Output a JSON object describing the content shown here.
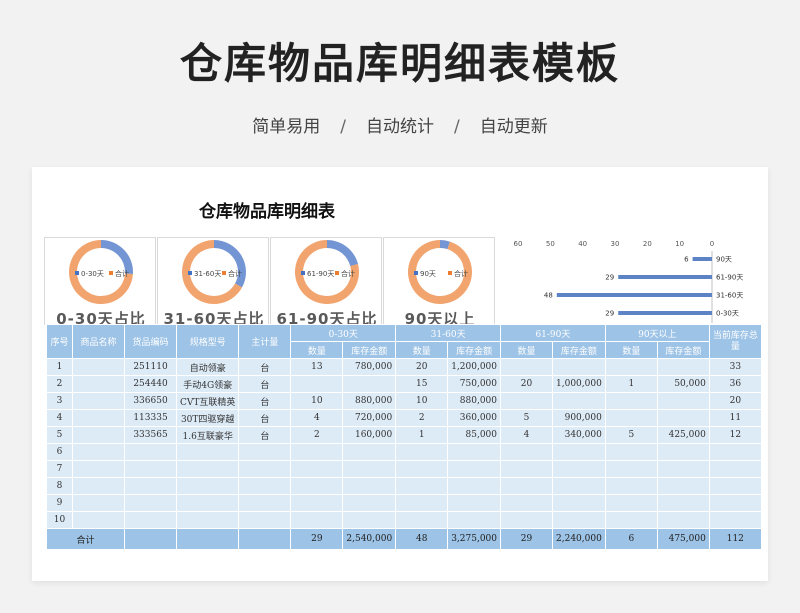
{
  "hero": {
    "title": "仓库物品库明细表模板",
    "subtitle": [
      "简单易用",
      "自动统计",
      "自动更新"
    ],
    "separator": "/"
  },
  "sheet_title": "仓库物品库明细表",
  "donuts": [
    {
      "legend": [
        "0-30天",
        "合计"
      ],
      "caption": "0-30天占比",
      "share": 0.26
    },
    {
      "legend": [
        "31-60天",
        "合计"
      ],
      "caption": "31-60天占比",
      "share": 0.33
    },
    {
      "legend": [
        "61-90天",
        "合计"
      ],
      "caption": "61-90天占比",
      "share": 0.21
    },
    {
      "legend": [
        "90天",
        "合计"
      ],
      "caption": "90天以上",
      "share": 0.05
    }
  ],
  "colors": {
    "blue": "#4472c4",
    "orange": "#ed7d31",
    "header": "#9dc3e6",
    "cell": "#ddebf7",
    "bar": "#5b83c6"
  },
  "chart_data": {
    "type": "bar",
    "orientation": "horizontal",
    "categories": [
      "90天",
      "61-90天",
      "31-60天",
      "0-30天"
    ],
    "values": [
      6,
      29,
      48,
      29
    ],
    "xticks": [
      60,
      50,
      40,
      30,
      20,
      10,
      0
    ],
    "xlim": [
      0,
      60
    ],
    "reversed_axis": true
  },
  "table": {
    "headers": {
      "seq": "序号",
      "name": "商品名称",
      "code": "货品编码",
      "spec": "规格型号",
      "unit": "主计量",
      "stock": "当前库存总量",
      "groups": [
        "0-30天",
        "31-60天",
        "61-90天",
        "90天以上"
      ],
      "qty": "数量",
      "amt": "库存金额"
    },
    "rows": [
      {
        "seq": "1",
        "name": "",
        "code": "251110",
        "spec": "自动领豪",
        "unit": "台",
        "g": [
          [
            "13",
            "780,000"
          ],
          [
            "20",
            "1,200,000"
          ],
          [
            "",
            ""
          ],
          [
            "",
            ""
          ]
        ],
        "total": "33"
      },
      {
        "seq": "2",
        "name": "",
        "code": "254440",
        "spec": "手动4G领豪",
        "unit": "台",
        "g": [
          [
            "",
            ""
          ],
          [
            "15",
            "750,000"
          ],
          [
            "20",
            "1,000,000"
          ],
          [
            "1",
            "50,000"
          ]
        ],
        "total": "36"
      },
      {
        "seq": "3",
        "name": "",
        "code": "336650",
        "spec": "CVT互联精英",
        "unit": "台",
        "g": [
          [
            "10",
            "880,000"
          ],
          [
            "10",
            "880,000"
          ],
          [
            "",
            ""
          ],
          [
            "",
            ""
          ]
        ],
        "total": "20"
      },
      {
        "seq": "4",
        "name": "",
        "code": "113335",
        "spec": "30T四驱穿越",
        "unit": "台",
        "g": [
          [
            "4",
            "720,000"
          ],
          [
            "2",
            "360,000"
          ],
          [
            "5",
            "900,000"
          ],
          [
            "",
            ""
          ]
        ],
        "total": "11"
      },
      {
        "seq": "5",
        "name": "",
        "code": "333565",
        "spec": "1.6互联豪华",
        "unit": "台",
        "g": [
          [
            "2",
            "160,000"
          ],
          [
            "1",
            "85,000"
          ],
          [
            "4",
            "340,000"
          ],
          [
            "5",
            "425,000"
          ]
        ],
        "total": "12"
      },
      {
        "seq": "6",
        "name": "",
        "code": "",
        "spec": "",
        "unit": "",
        "g": [
          [
            "",
            ""
          ],
          [
            "",
            ""
          ],
          [
            "",
            ""
          ],
          [
            "",
            ""
          ]
        ],
        "total": ""
      },
      {
        "seq": "7",
        "name": "",
        "code": "",
        "spec": "",
        "unit": "",
        "g": [
          [
            "",
            ""
          ],
          [
            "",
            ""
          ],
          [
            "",
            ""
          ],
          [
            "",
            ""
          ]
        ],
        "total": ""
      },
      {
        "seq": "8",
        "name": "",
        "code": "",
        "spec": "",
        "unit": "",
        "g": [
          [
            "",
            ""
          ],
          [
            "",
            ""
          ],
          [
            "",
            ""
          ],
          [
            "",
            ""
          ]
        ],
        "total": ""
      },
      {
        "seq": "9",
        "name": "",
        "code": "",
        "spec": "",
        "unit": "",
        "g": [
          [
            "",
            ""
          ],
          [
            "",
            ""
          ],
          [
            "",
            ""
          ],
          [
            "",
            ""
          ]
        ],
        "total": ""
      },
      {
        "seq": "10",
        "name": "",
        "code": "",
        "spec": "",
        "unit": "",
        "g": [
          [
            "",
            ""
          ],
          [
            "",
            ""
          ],
          [
            "",
            ""
          ],
          [
            "",
            ""
          ]
        ],
        "total": ""
      }
    ],
    "footer": {
      "label": "合计",
      "g": [
        [
          "29",
          "2,540,000"
        ],
        [
          "48",
          "3,275,000"
        ],
        [
          "29",
          "2,240,000"
        ],
        [
          "6",
          "475,000"
        ]
      ],
      "total": "112"
    }
  }
}
